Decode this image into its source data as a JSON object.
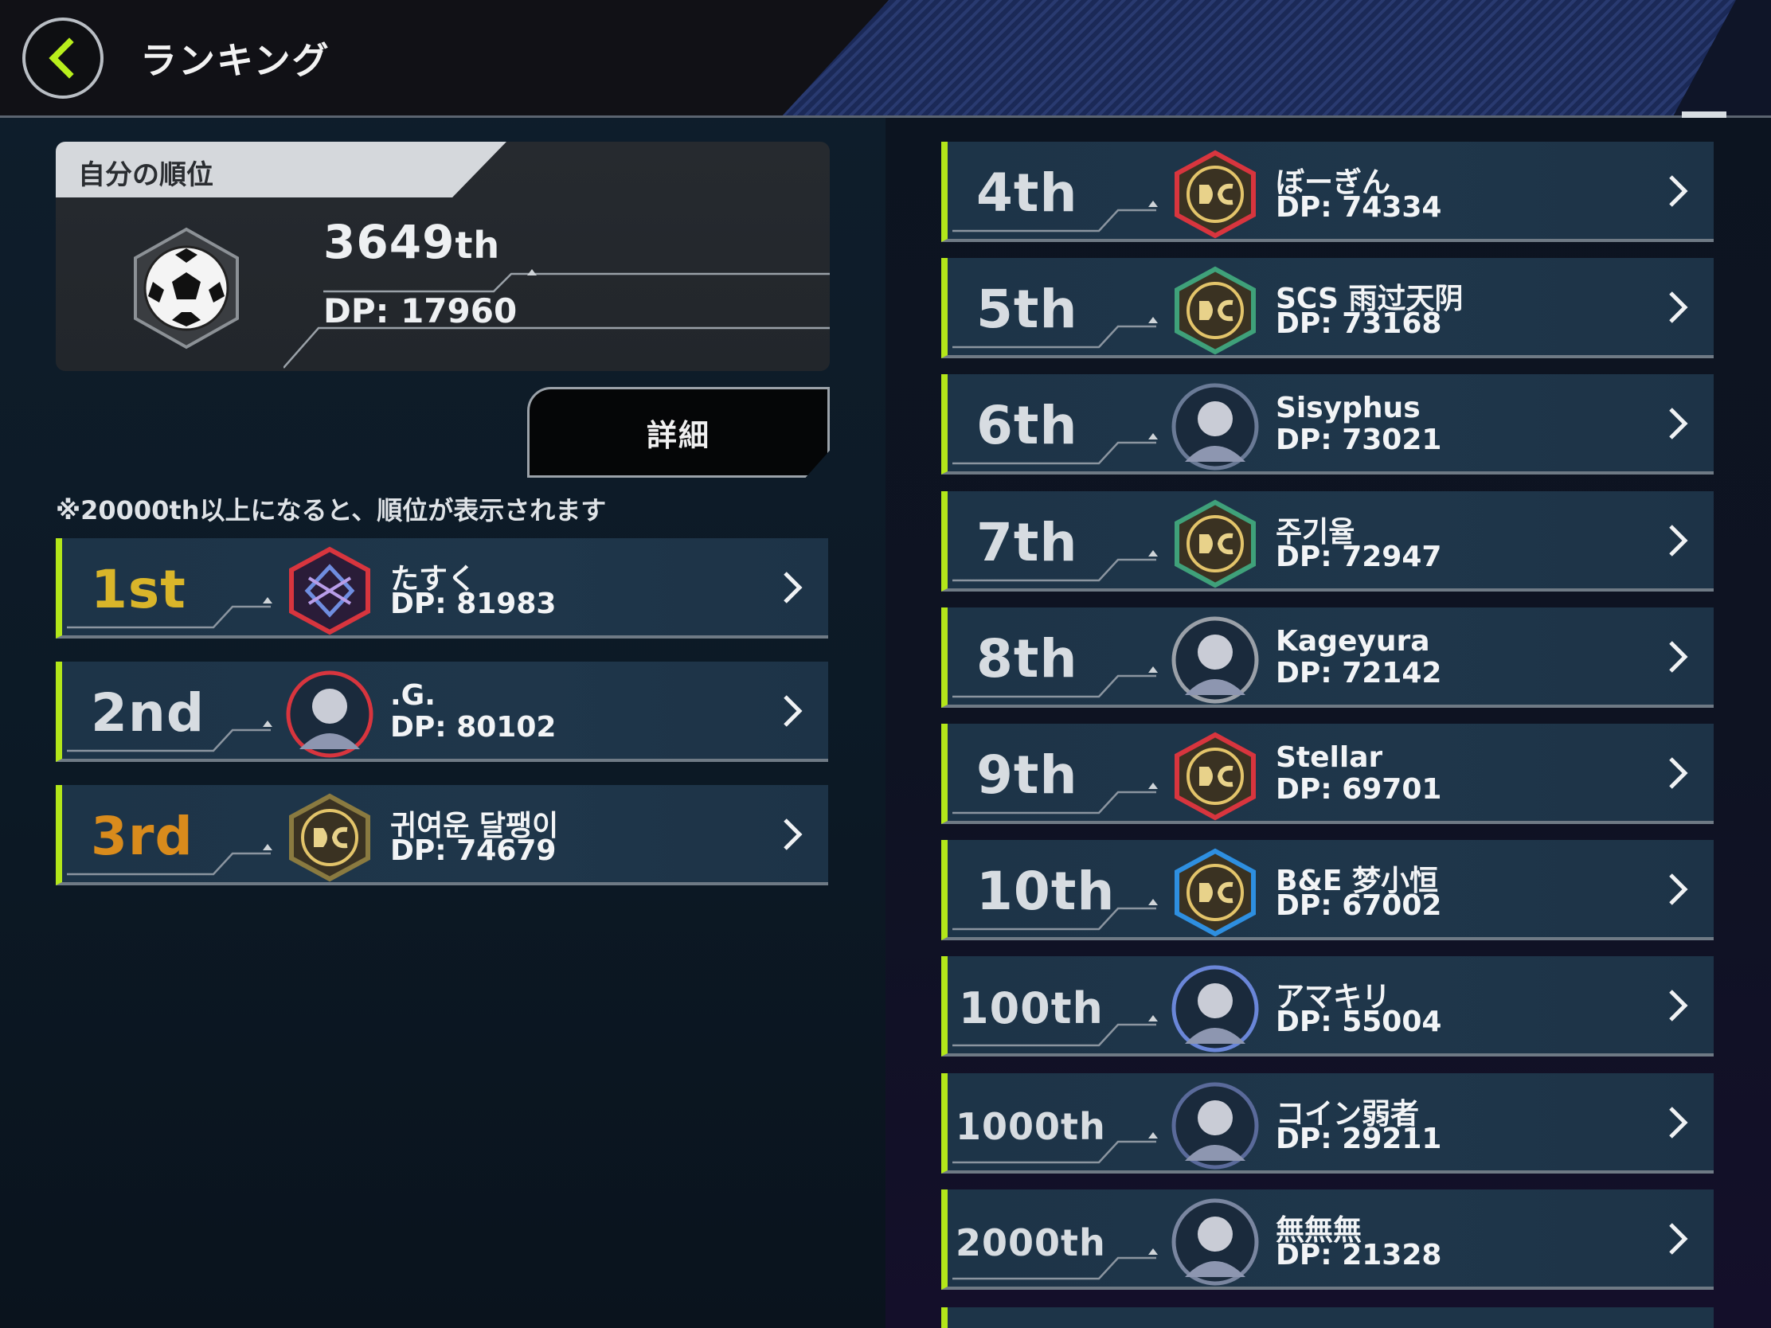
{
  "header": {
    "title": "ランキング"
  },
  "my_rank": {
    "tab_label": "自分の順位",
    "rank": "3649",
    "rank_suffix": "th",
    "dp": "DP: 17960",
    "icon": "soccer-ball-icon"
  },
  "detail_button": {
    "label": "詳細"
  },
  "note": "※20000th以上になると、順位が表示されます",
  "left_ranking": [
    {
      "rank": "1st",
      "name": "たすく",
      "dp": "DP: 81983",
      "style": "gold",
      "avatar": "emblem-icon"
    },
    {
      "rank": "2nd",
      "name": ".G.",
      "dp": "DP: 80102",
      "style": "silver",
      "avatar": "character-icon"
    },
    {
      "rank": "3rd",
      "name": "귀여운 달팽이",
      "dp": "DP: 74679",
      "style": "bronze",
      "avatar": "dc-badge-icon"
    }
  ],
  "right_ranking": [
    {
      "rank": "4th",
      "name": "ぼーぎん",
      "dp": "DP: 74334",
      "avatar": "dc-badge-icon"
    },
    {
      "rank": "5th",
      "name": "SCS 雨过天阴",
      "dp": "DP: 73168",
      "avatar": "dc-badge-icon"
    },
    {
      "rank": "6th",
      "name": "Sisyphus",
      "dp": "DP: 73021",
      "avatar": "character-icon"
    },
    {
      "rank": "7th",
      "name": "주기율",
      "dp": "DP: 72947",
      "avatar": "dc-badge-icon"
    },
    {
      "rank": "8th",
      "name": "Kageyura",
      "dp": "DP: 72142",
      "avatar": "character-icon"
    },
    {
      "rank": "9th",
      "name": "Stellar",
      "dp": "DP: 69701",
      "avatar": "dc-badge-icon"
    },
    {
      "rank": "10th",
      "name": "B&E 梦小恒",
      "dp": "DP: 67002",
      "avatar": "dc-badge-icon"
    },
    {
      "rank": "100th",
      "name": "アマキリ",
      "dp": "DP: 55004",
      "avatar": "character-icon"
    },
    {
      "rank": "1000th",
      "name": "コイン弱者",
      "dp": "DP: 29211",
      "avatar": "character-icon"
    },
    {
      "rank": "2000th",
      "name": "無無無",
      "dp": "DP: 21328",
      "avatar": "character-icon"
    }
  ],
  "colors": {
    "accent": "#b3e61a",
    "row_bg": "#1d3448",
    "gold": "#d9b52a",
    "bronze": "#d98b1c"
  }
}
